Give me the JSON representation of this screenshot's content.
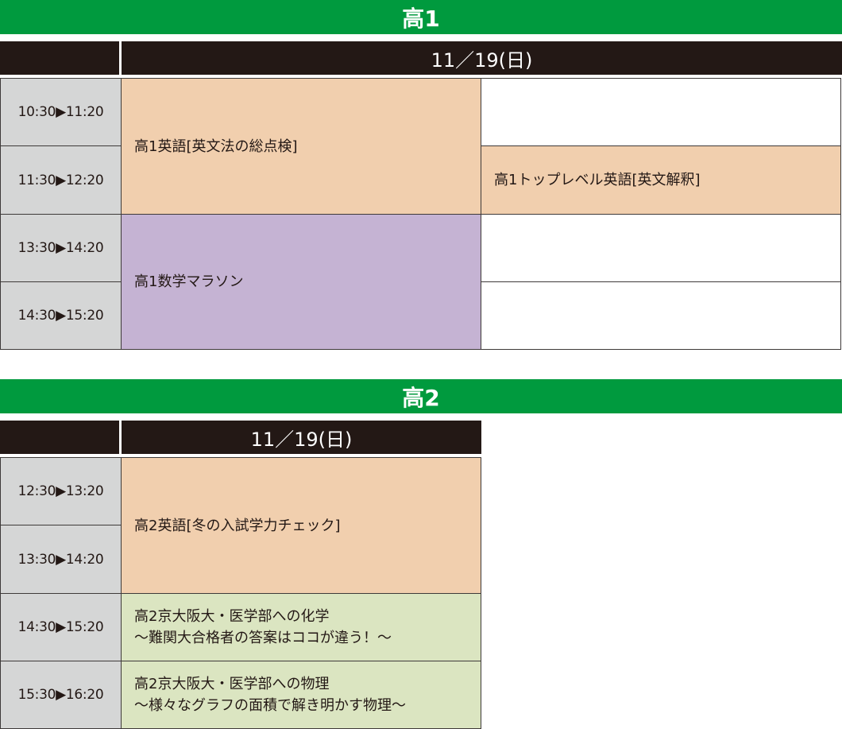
{
  "colors": {
    "grade_bar": "#009a3e",
    "date_header": "#231815",
    "time_cell": "#d5d6d6",
    "english": "#f1cfae",
    "math": "#c5b3d3",
    "science": "#dbe5c1",
    "border": "#3e3a39"
  },
  "icons": {
    "time_separator": "triangle-right-icon"
  },
  "grade1": {
    "title": "高1",
    "date": "11／19(日)",
    "times": [
      {
        "start": "10:30",
        "end": "11:20"
      },
      {
        "start": "11:30",
        "end": "12:20"
      },
      {
        "start": "13:30",
        "end": "14:20"
      },
      {
        "start": "14:30",
        "end": "15:20"
      }
    ],
    "sessions": {
      "english": "高1英語[英文法の総点検]",
      "top_english": "高1トップレベル英語[英文解釈]",
      "math": "高1数学マラソン"
    }
  },
  "grade2": {
    "title": "高2",
    "date": "11／19(日)",
    "times": [
      {
        "start": "12:30",
        "end": "13:20"
      },
      {
        "start": "13:30",
        "end": "14:20"
      },
      {
        "start": "14:30",
        "end": "15:20"
      },
      {
        "start": "15:30",
        "end": "16:20"
      }
    ],
    "sessions": {
      "english": "高2英語[冬の入試学力チェック]",
      "chemistry": {
        "line1": "高2京大阪大・医学部への化学",
        "line2": "～難関大合格者の答案はココが違う！～"
      },
      "physics": {
        "line1": "高2京大阪大・医学部への物理",
        "line2": "～様々なグラフの面積で解き明かす物理～"
      }
    }
  }
}
